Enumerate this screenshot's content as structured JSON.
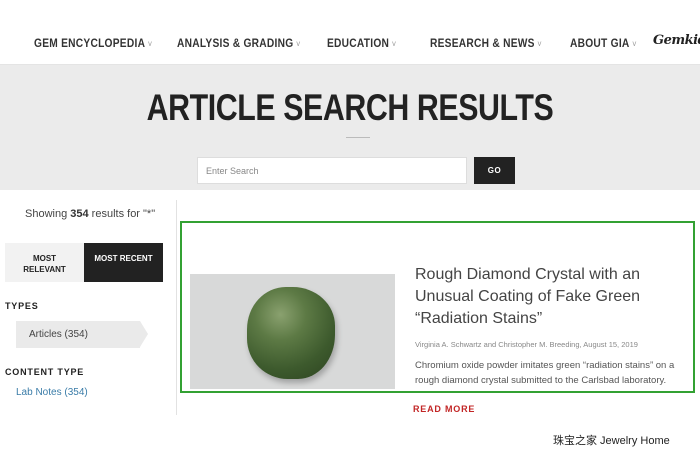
{
  "nav": {
    "items": [
      {
        "label": "GEM ENCYCLOPEDIA",
        "chev": "˅"
      },
      {
        "label": "ANALYSIS & GRADING",
        "chev": "˅"
      },
      {
        "label": "EDUCATION",
        "chev": "˅"
      },
      {
        "label": "RESEARCH & NEWS",
        "chev": "˅"
      },
      {
        "label": "ABOUT GIA",
        "chev": "˅"
      }
    ],
    "logo": "Gemkids"
  },
  "hero": {
    "title": "ARTICLE SEARCH RESULTS",
    "search_placeholder": "Enter Search",
    "search_value": "",
    "search_button": "GO"
  },
  "results": {
    "prefix": "Showing ",
    "count": "354",
    "middle": " results for ",
    "query": "\"*\""
  },
  "sort": {
    "relevant_line1": "MOST",
    "relevant_line2": "RELEVANT",
    "recent": "MOST RECENT"
  },
  "facets": {
    "types_heading": "TYPES",
    "types_item": "Articles (354)",
    "content_heading": "CONTENT TYPE",
    "content_item": "Lab Notes (354)"
  },
  "result": {
    "title": "Rough Diamond Crystal with an Unusual Coating of Fake Green “Radiation Stains”",
    "meta": "Virginia A. Schwartz and Christopher M. Breeding, August 15, 2019",
    "description": "Chromium oxide powder imitates green “radiation stains” on a rough diamond crystal submitted to the Carlsbad laboratory.",
    "read_more": "READ MORE",
    "highlight_color": "#33a133"
  },
  "watermark": "珠宝之家  Jewelry Home"
}
